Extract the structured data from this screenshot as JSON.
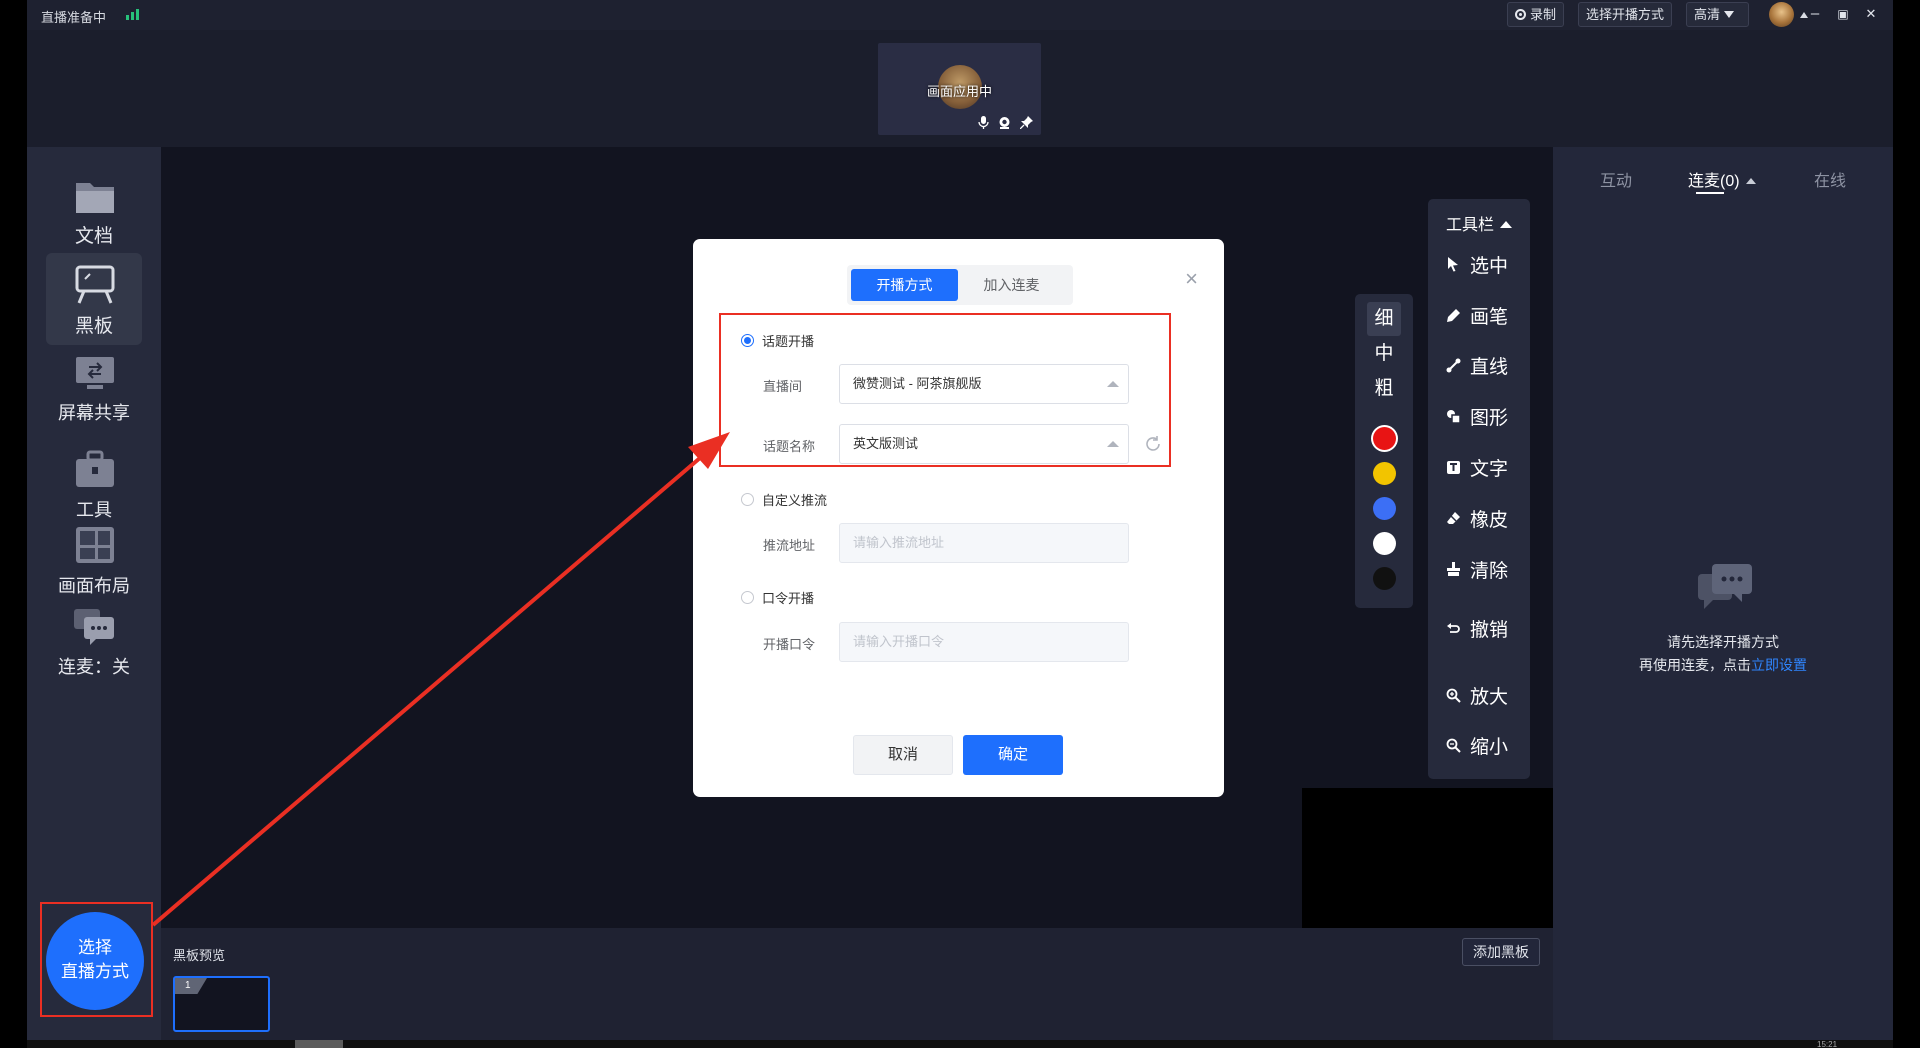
{
  "titlebar": {
    "status": "直播准备中",
    "record_label": "录制",
    "choose_mode_label": "选择开播方式",
    "quality_label": "高清",
    "minimize": "–",
    "restore": "▣",
    "close": "✕"
  },
  "preview": {
    "label": "画面应用中",
    "icons": [
      "mic-icon",
      "camera-icon",
      "pin-icon"
    ]
  },
  "sidebar": {
    "items": [
      {
        "label": "文档",
        "icon": "folder-icon"
      },
      {
        "label": "黑板",
        "icon": "blackboard-icon",
        "active": true
      },
      {
        "label": "屏幕共享",
        "icon": "monitor-icon"
      },
      {
        "label": "工具",
        "icon": "briefcase-icon"
      },
      {
        "label": "画面布局",
        "icon": "layout-icon"
      },
      {
        "label": "连麦：关",
        "icon": "chat-icon"
      }
    ],
    "select_mode": {
      "line1": "选择",
      "line2": "直播方式"
    }
  },
  "pen_panel": {
    "sizes": [
      "细",
      "中",
      "粗"
    ],
    "active_size": "细",
    "colors": [
      "#e81414",
      "#f2c400",
      "#3c6ff5",
      "#ffffff",
      "#111111"
    ]
  },
  "toolbar": {
    "title": "工具栏",
    "tools": [
      {
        "label": "选中",
        "icon": "cursor-icon"
      },
      {
        "label": "画笔",
        "icon": "pen-icon"
      },
      {
        "label": "直线",
        "icon": "line-icon"
      },
      {
        "label": "图形",
        "icon": "shapes-icon"
      },
      {
        "label": "文字",
        "icon": "text-icon"
      },
      {
        "label": "橡皮",
        "icon": "eraser-icon"
      },
      {
        "label": "清除",
        "icon": "clear-icon"
      },
      {
        "label": "撤销",
        "icon": "undo-icon"
      },
      {
        "label": "放大",
        "icon": "zoom-in-icon"
      },
      {
        "label": "缩小",
        "icon": "zoom-out-icon"
      }
    ]
  },
  "blackboard": {
    "preview_title": "黑板预览",
    "add_label": "添加黑板",
    "thumb_number": "1"
  },
  "right_panel": {
    "tabs": [
      "互动",
      "连麦(0)",
      "在线"
    ],
    "active_tab": "连麦(0)",
    "msg_line1": "请先选择开播方式",
    "msg_line2": "再使用连麦，点击",
    "msg_link": "立即设置"
  },
  "dialog": {
    "tabs": [
      "开播方式",
      "加入连麦"
    ],
    "active_tab": "开播方式",
    "close": "×",
    "option_topic": "话题开播",
    "room_label": "直播间",
    "room_value": "微赞测试 - 阿茶旗舰版",
    "topic_label": "话题名称",
    "topic_value": "英文版测试",
    "option_custom": "自定义推流",
    "push_label": "推流地址",
    "push_placeholder": "请输入推流地址",
    "option_password": "口令开播",
    "password_label": "开播口令",
    "password_placeholder": "请输入开播口令",
    "cancel": "取消",
    "confirm": "确定"
  },
  "bottom": {
    "time": "15:21"
  }
}
